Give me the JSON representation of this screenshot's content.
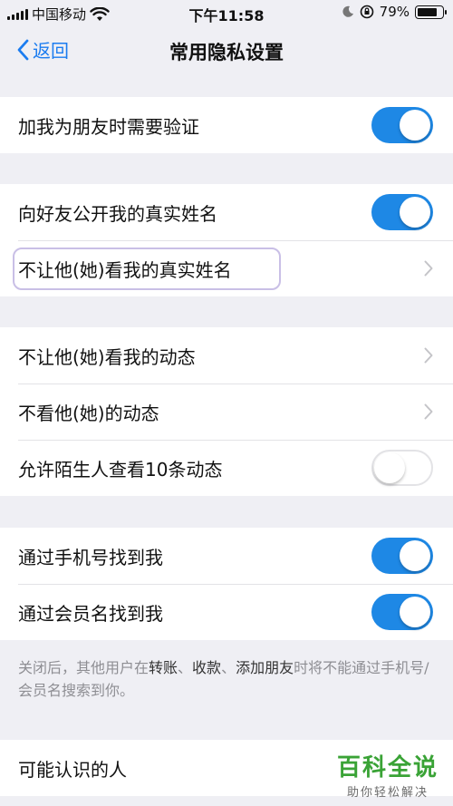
{
  "status": {
    "carrier": "中国移动",
    "time": "下午11:58",
    "battery": "79%",
    "battery_level": 0.79
  },
  "nav": {
    "back": "返回",
    "title": "常用隐私设置"
  },
  "groups": {
    "g1": {
      "r1": {
        "label": "加我为朋友时需要验证",
        "on": true
      }
    },
    "g2": {
      "r1": {
        "label": "向好友公开我的真实姓名",
        "on": true
      },
      "r2": {
        "label": "不让他(她)看我的真实姓名"
      }
    },
    "g3": {
      "r1": {
        "label": "不让他(她)看我的动态"
      },
      "r2": {
        "label": "不看他(她)的动态"
      },
      "r3": {
        "label": "允许陌生人查看10条动态",
        "on": false
      }
    },
    "g4": {
      "r1": {
        "label": "通过手机号找到我",
        "on": true
      },
      "r2": {
        "label": "通过会员名找到我",
        "on": true
      }
    },
    "g5": {
      "r1": {
        "label": "可能认识的人"
      }
    }
  },
  "note": {
    "p1": "关闭后，其他用户在",
    "b1": "转账",
    "s1": "、",
    "b2": "收款",
    "s2": "、",
    "b3": "添加朋友",
    "p2": "时将不能通过手机号/会员名搜索到你。"
  },
  "watermark": {
    "title": "百科全说",
    "subtitle": "助你轻松解决"
  },
  "colors": {
    "accent": "#1b7cf0",
    "toggle_on": "#1e88e5",
    "watermark": "#3aa336"
  }
}
